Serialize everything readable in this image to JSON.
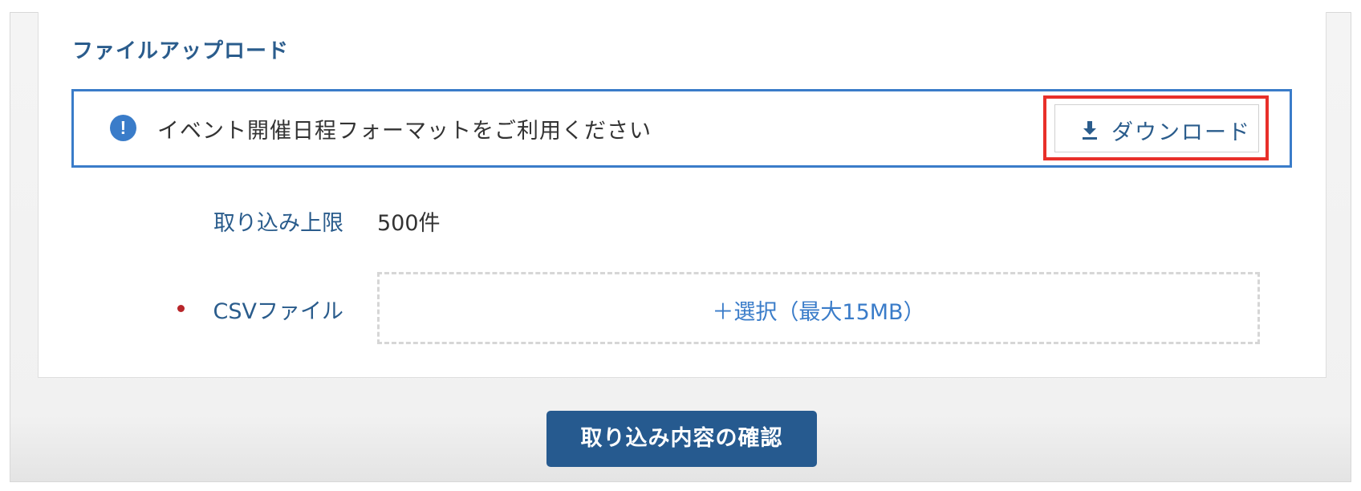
{
  "section": {
    "title": "ファイルアップロード"
  },
  "notice": {
    "icon": "exclamation-circle-icon",
    "text": "イベント開催日程フォーマットをご利用ください",
    "download_icon": "download-icon",
    "download_label": "ダウンロード"
  },
  "import_limit": {
    "label": "取り込み上限",
    "value": "500件"
  },
  "csv_file": {
    "label": "CSVファイル",
    "required": true,
    "select_label": "＋選択（最大15MB）"
  },
  "confirm_button": {
    "label": "取り込み内容の確認"
  },
  "colors": {
    "primary": "#265a8f",
    "accent_blue": "#3a7cc9",
    "highlight_red": "#e8302a",
    "required_red": "#b8262a",
    "label_blue": "#2a5c8c"
  }
}
